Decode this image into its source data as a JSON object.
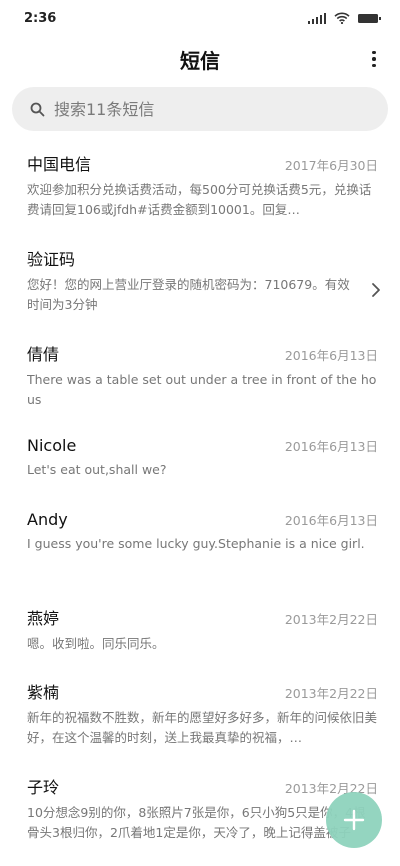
{
  "status_bar": {
    "time": "2:36"
  },
  "header": {
    "title": "短信",
    "more_icon": "more-vertical-icon"
  },
  "search": {
    "placeholder": "搜索11条短信",
    "icon": "search-icon"
  },
  "messages": [
    {
      "name": "中国电信",
      "date": "2017年6月30日",
      "preview": "欢迎参加积分兑换话费活动，每500分可兑换话费5元，兑换话费请回复106或jfdh#话费金额到10001。回复…"
    },
    {
      "name": "验证码",
      "date": "",
      "preview": "您好！您的网上营业厅登录的随机密码为：710679。有效时间为3分钟"
    },
    {
      "name": "倩倩",
      "date": "2016年6月13日",
      "preview": "There was a table set out under a tree in front of the hous"
    },
    {
      "name": "Nicole",
      "date": "2016年6月13日",
      "preview": "Let's eat out,shall we?"
    },
    {
      "name": "Andy",
      "date": "2016年6月13日",
      "preview": "I guess you're some lucky guy.Stephanie is a nice girl."
    },
    {
      "name": "燕婷",
      "date": "2013年2月22日",
      "preview": "嗯。收到啦。同乐同乐。"
    },
    {
      "name": "紫楠",
      "date": "2013年2月22日",
      "preview": "新年的祝福数不胜数，新年的愿望好多好多，新年的问候依旧美好，在这个温馨的时刻，送上我最真挚的祝福，…"
    },
    {
      "name": "子玲",
      "date": "2013年2月22日",
      "preview": "10分想念9别的你，8张照片7张是你，6只小狗5只是你，4根骨头3根归你，2爪着地1定是你，天冷了，晚上记得盖被子"
    }
  ],
  "colors": {
    "fab": "#8fd3bd",
    "search_bg": "#eeeeee"
  }
}
